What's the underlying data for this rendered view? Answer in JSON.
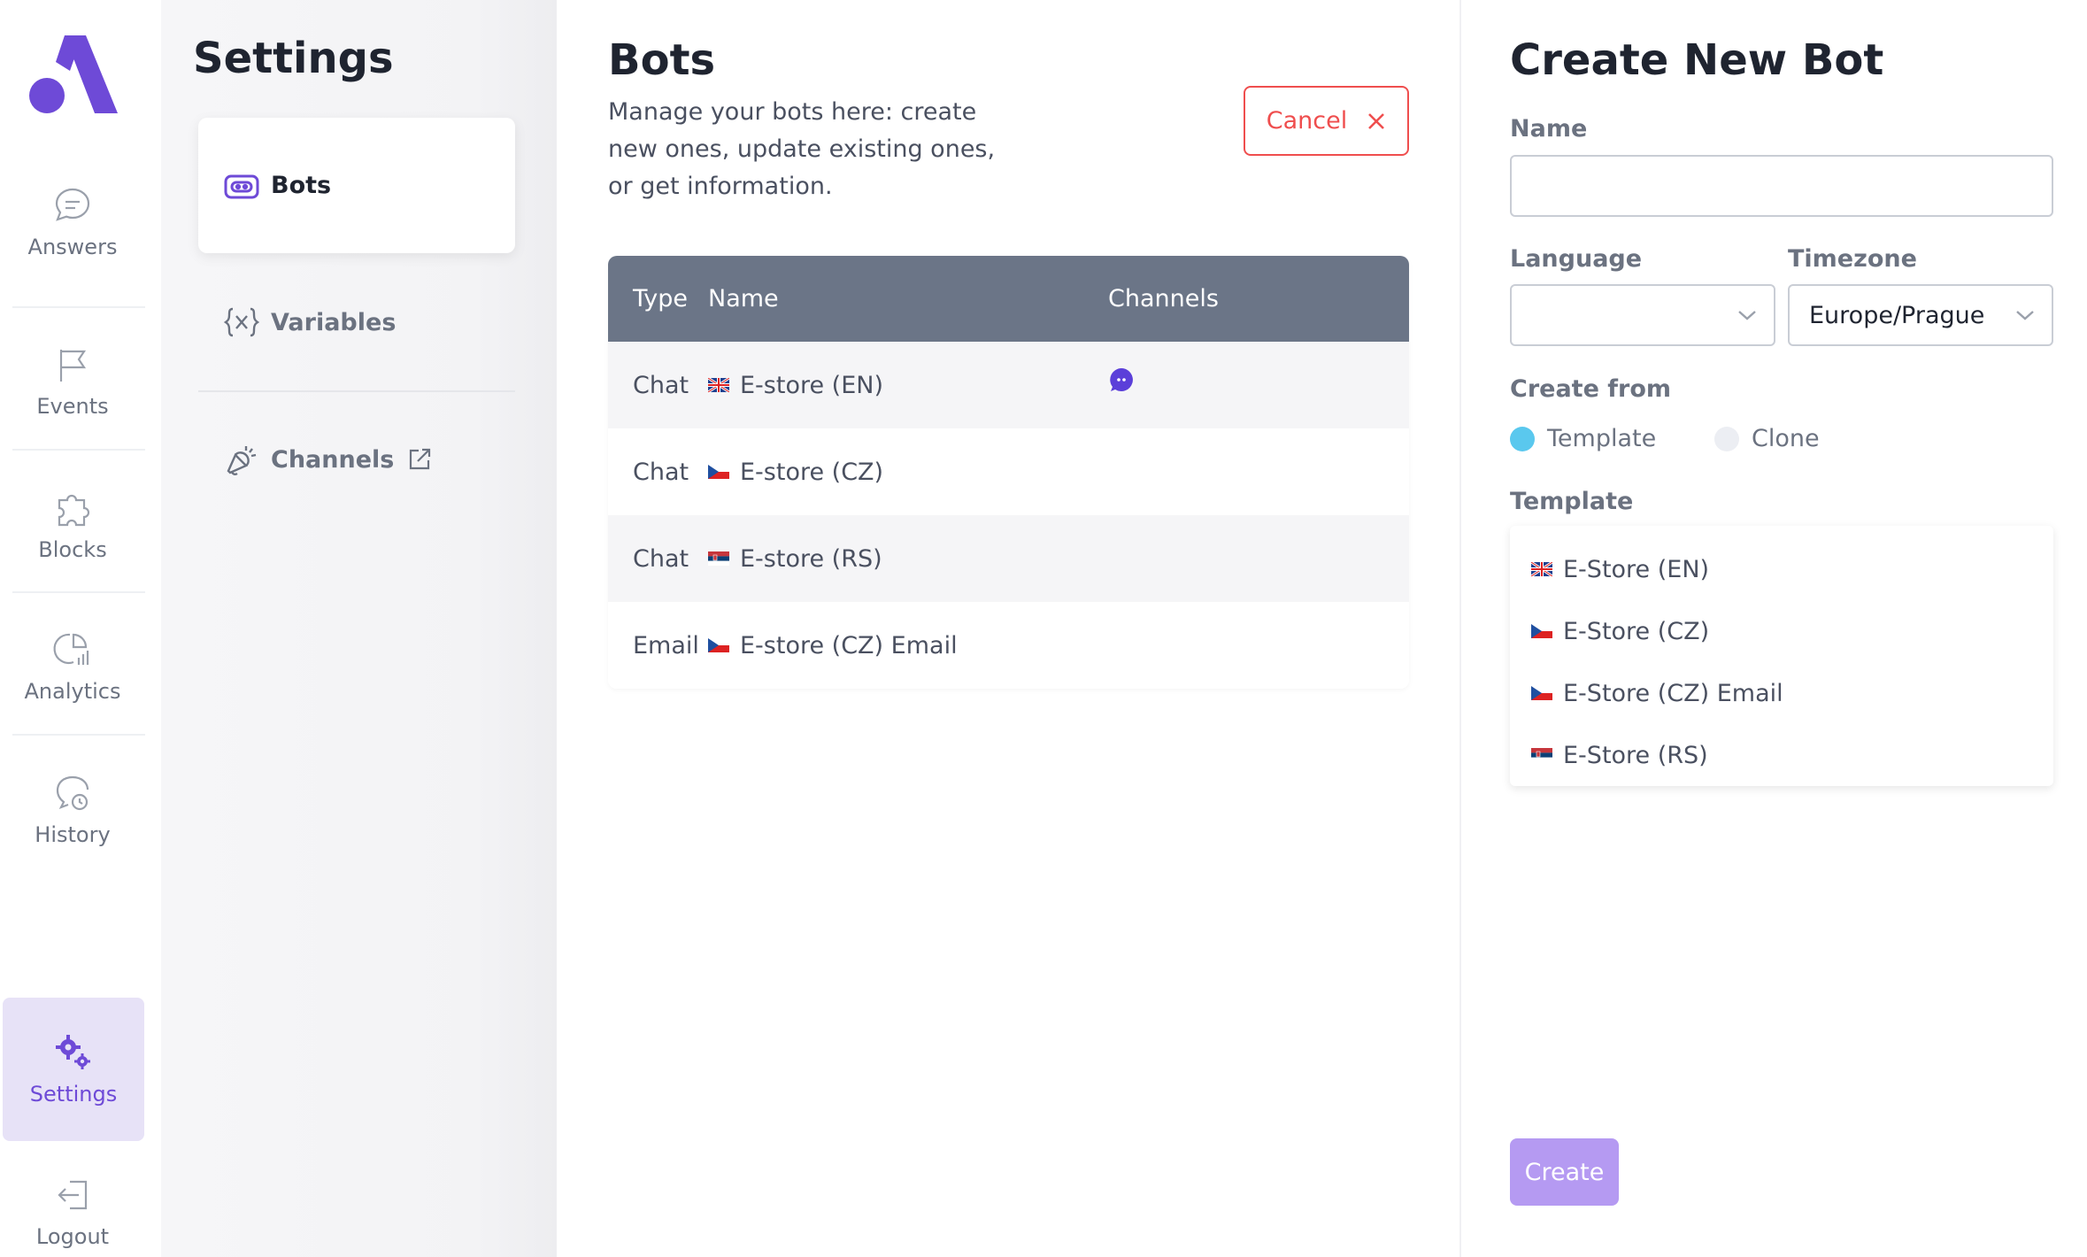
{
  "nav": {
    "items": [
      {
        "label": "Answers",
        "icon": "chat-bubble-icon"
      },
      {
        "label": "Events",
        "icon": "flag-icon"
      },
      {
        "label": "Blocks",
        "icon": "puzzle-icon"
      },
      {
        "label": "Analytics",
        "icon": "analytics-icon"
      },
      {
        "label": "History",
        "icon": "history-icon"
      },
      {
        "label": "Settings",
        "icon": "gears-icon",
        "active": true
      },
      {
        "label": "Logout",
        "icon": "logout-icon"
      }
    ]
  },
  "settings": {
    "title": "Settings",
    "items": [
      {
        "label": "Bots",
        "icon": "bot-icon",
        "active": true
      },
      {
        "label": "Variables",
        "icon": "variables-icon"
      },
      {
        "label": "Channels",
        "icon": "megaphone-icon",
        "external": true
      }
    ]
  },
  "bots": {
    "title": "Bots",
    "description": "Manage your bots here: create new ones, update existing ones, or get information.",
    "cancel_label": "Cancel",
    "table": {
      "columns": [
        "Type",
        "Name",
        "Channels"
      ],
      "rows": [
        {
          "type": "Chat",
          "flag": "gb",
          "name": "E-store (EN)",
          "channel_icon": "chat-channel-icon"
        },
        {
          "type": "Chat",
          "flag": "cz",
          "name": "E-store (CZ)",
          "channel_icon": ""
        },
        {
          "type": "Chat",
          "flag": "rs",
          "name": "E-store (RS)",
          "channel_icon": ""
        },
        {
          "type": "Email",
          "flag": "cz",
          "name": "E-store (CZ) Email",
          "channel_icon": ""
        }
      ]
    }
  },
  "create": {
    "title": "Create New Bot",
    "name_label": "Name",
    "name_value": "",
    "language_label": "Language",
    "language_value": "",
    "timezone_label": "Timezone",
    "timezone_value": "Europe/Prague",
    "create_from_label": "Create from",
    "options": [
      {
        "label": "Template",
        "selected": true
      },
      {
        "label": "Clone",
        "selected": false
      }
    ],
    "template_label": "Template",
    "templates": [
      {
        "flag": "gb",
        "name": "E-Store (EN)"
      },
      {
        "flag": "cz",
        "name": "E-Store (CZ)"
      },
      {
        "flag": "cz",
        "name": "E-Store (CZ) Email"
      },
      {
        "flag": "rs",
        "name": "E-Store (RS)"
      }
    ],
    "create_label": "Create"
  },
  "colors": {
    "accent": "#6e4ad7",
    "cancel": "#ef4e4e",
    "table_header": "#6b7587",
    "create_button": "#b59af2",
    "radio_selected": "#5ac8ee"
  }
}
